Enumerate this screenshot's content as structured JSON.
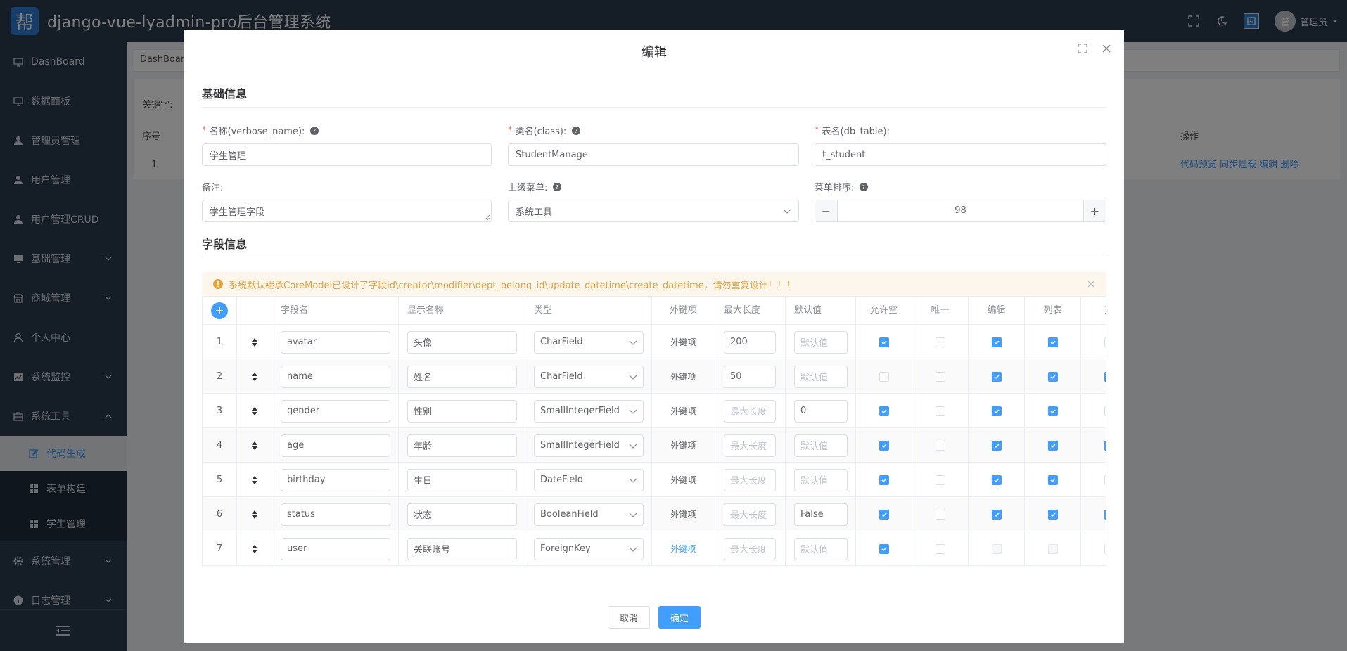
{
  "header": {
    "logo_char": "帮",
    "title": "django-vue-lyadmin-pro后台管理系统",
    "avatar_char": "管",
    "user_name": "管理员"
  },
  "sidebar": {
    "items": [
      {
        "label": "DashBoard",
        "icon": "monitor-icon"
      },
      {
        "label": "数据面板",
        "icon": "monitor-icon"
      },
      {
        "label": "管理员管理",
        "icon": "user-icon"
      },
      {
        "label": "用户管理",
        "icon": "user-icon"
      },
      {
        "label": "用户管理CRUD",
        "icon": "user-icon"
      },
      {
        "label": "基础管理",
        "icon": "desktop-icon"
      },
      {
        "label": "商城管理",
        "icon": "shop-icon"
      },
      {
        "label": "个人中心",
        "icon": "user-outline-icon"
      },
      {
        "label": "系统监控",
        "icon": "chart-icon"
      },
      {
        "label": "系统工具",
        "icon": "toolbox-icon"
      },
      {
        "label": "代码生成",
        "icon": "edit-icon"
      },
      {
        "label": "表单构建",
        "icon": "grid-icon"
      },
      {
        "label": "学生管理",
        "icon": "grid-icon"
      },
      {
        "label": "系统管理",
        "icon": "gear-icon"
      },
      {
        "label": "日志管理",
        "icon": "info-icon"
      }
    ]
  },
  "bg": {
    "tab": "DashBoard",
    "search_label": "关键字:",
    "col_index": "序号",
    "col_ops": "操作",
    "row_index": "1",
    "ops": [
      "代码预览",
      "同步挂载",
      "编辑",
      "删除"
    ]
  },
  "dialog": {
    "title": "编辑",
    "basic_section": "基础信息",
    "field_section": "字段信息",
    "form": {
      "name_label": "名称(verbose_name):",
      "name_value": "学生管理",
      "class_label": "类名(class):",
      "class_value": "StudentManage",
      "table_label": "表名(db_table):",
      "table_value": "t_student",
      "remark_label": "备注:",
      "remark_value": "学生管理字段",
      "parent_label": "上级菜单:",
      "parent_value": "系统工具",
      "sort_label": "菜单排序:",
      "sort_value": "98",
      "minus": "−",
      "plus": "+"
    },
    "alert": "系统默认继承CoreModel已设计了字段id\\creator\\modifier\\dept_belong_id\\update_datetime\\create_datetime，请勿重复设计！！！",
    "columns": [
      "字段名",
      "显示名称",
      "类型",
      "外键项",
      "最大长度",
      "默认值",
      "允许空",
      "唯一",
      "编辑",
      "列表",
      "查"
    ],
    "placeholders": {
      "max_len": "最大长度",
      "default": "默认值"
    },
    "rows": [
      {
        "idx": "1",
        "field": "avatar",
        "display": "头像",
        "type": "CharField",
        "fk": "外键项",
        "fk_link": false,
        "max_len": "200",
        "default": "",
        "nullable": true,
        "unique": false,
        "edit": true,
        "list": true,
        "query": false,
        "edit_dis": false
      },
      {
        "idx": "2",
        "field": "name",
        "display": "姓名",
        "type": "CharField",
        "fk": "外键项",
        "fk_link": false,
        "max_len": "50",
        "default": "",
        "nullable": false,
        "unique": false,
        "edit": true,
        "list": true,
        "query": true,
        "edit_dis": false
      },
      {
        "idx": "3",
        "field": "gender",
        "display": "性别",
        "type": "SmallIntegerField",
        "fk": "外键项",
        "fk_link": false,
        "max_len": "",
        "default": "0",
        "nullable": true,
        "unique": false,
        "edit": true,
        "list": true,
        "query": false,
        "edit_dis": false
      },
      {
        "idx": "4",
        "field": "age",
        "display": "年龄",
        "type": "SmallIntegerField",
        "fk": "外键项",
        "fk_link": false,
        "max_len": "",
        "default": "",
        "nullable": true,
        "unique": false,
        "edit": true,
        "list": true,
        "query": true,
        "edit_dis": false
      },
      {
        "idx": "5",
        "field": "birthday",
        "display": "生日",
        "type": "DateField",
        "fk": "外键项",
        "fk_link": false,
        "max_len": "",
        "default": "",
        "nullable": true,
        "unique": false,
        "edit": true,
        "list": true,
        "query": false,
        "edit_dis": false
      },
      {
        "idx": "6",
        "field": "status",
        "display": "状态",
        "type": "BooleanField",
        "fk": "外键项",
        "fk_link": false,
        "max_len": "",
        "default": "False",
        "nullable": true,
        "unique": false,
        "edit": true,
        "list": true,
        "query": true,
        "edit_dis": false
      },
      {
        "idx": "7",
        "field": "user",
        "display": "关联账号",
        "type": "ForeignKey",
        "fk": "外键项",
        "fk_link": true,
        "max_len": "",
        "default": "",
        "nullable": true,
        "unique": false,
        "edit": false,
        "list": false,
        "query": false,
        "edit_dis": true
      }
    ],
    "cancel": "取消",
    "confirm": "确定"
  },
  "colors": {
    "primary": "#409eff",
    "sidebar": "#2a3a4e",
    "warning": "#e6a23c",
    "danger": "#f56c6c"
  }
}
